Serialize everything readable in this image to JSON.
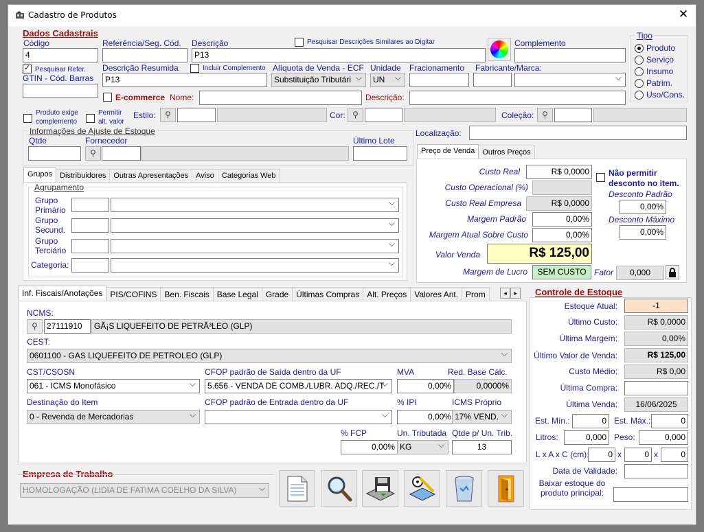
{
  "window": {
    "title": "Cadastro de Produtos",
    "close": "✕"
  },
  "dados": {
    "section": "Dados Cadastrais",
    "codigo_label": "Código",
    "codigo": "4",
    "ref_label": "Referência/Seg. Cód.",
    "ref": "",
    "desc_label": "Descrição",
    "desc": "P13",
    "pesquisar_similares": "Pesquisar Descrições Similares ao Digitar",
    "complemento_label": "Complemento",
    "complemento": "",
    "pesq_refer": "Pesquisar Refer.",
    "gtin_label": "GTIN - Cód. Barras",
    "gtin": "",
    "desc_resumida_label": "Descrição Resumida",
    "desc_resumida": "P13",
    "incluir_complemento": "Incluir Complemento",
    "aliquota_label": "Alíquota de Venda - ECF",
    "aliquota": "Substituição Tributári",
    "unidade_label": "Unidade",
    "unidade": "UN",
    "fracionamento_label": "Fracionamento",
    "fracionamento": "",
    "fabricante_label": "Fabricante/Marca:",
    "fabricante": "",
    "ecommerce": "E-commerce",
    "nome_label": "Nome:",
    "nome": "",
    "descricao2_label": "Descrição:",
    "descricao2": "",
    "exige_compl": "Produto exige complemento",
    "permitir_alt": "Permitir alt. valor",
    "estilo_label": "Estilo:",
    "cor_label": "Cor:",
    "colecao_label": "Coleção:"
  },
  "tipo": {
    "title": "Tipo",
    "options": [
      "Produto",
      "Serviço",
      "Insumo",
      "Patrim.",
      "Uso/Cons."
    ],
    "selected": 0
  },
  "ajuste": {
    "title": "Informações de Ajuste de Estoque",
    "qtde_label": "Qtde",
    "fornecedor_label": "Fornecedor",
    "ultimo_lote_label": "Último Lote"
  },
  "localizacao_label": "Localização:",
  "left_tabs": [
    "Grupos",
    "Distribuidores",
    "Outras Apresentações",
    "Aviso",
    "Categorias Web"
  ],
  "agrupamento": {
    "title": "Agrupamento",
    "gp1": "Grupo Primário",
    "gp2": "Grupo Secund.",
    "gp3": "Grupo Terciário",
    "categoria": "Categoria:"
  },
  "preco_tabs": [
    "Preço de Venda",
    "Outros Preços"
  ],
  "preco": {
    "custo_real_label": "Custo Real",
    "custo_real": "R$ 0,0000",
    "custo_op_label": "Custo Operacional (%)",
    "custo_op": "",
    "custo_emp_label": "Custo Real Empresa",
    "custo_emp": "R$ 0,0000",
    "margem_padrao_label": "Margem Padrão",
    "margem_padrao": "0,00%",
    "margem_atual_label": "Margem Atual Sobre Custo",
    "margem_atual": "0,00%",
    "valor_venda_label": "Valor Venda",
    "valor_venda": "R$ 125,00",
    "margem_lucro_label": "Margem de Lucro",
    "margem_lucro": "SEM CUSTO",
    "fator_label": "Fator",
    "fator": "0,000",
    "nao_permitir": "Não permitir desconto no item.",
    "desc_padrao_label": "Desconto Padrão",
    "desc_padrao": "0,00%",
    "desc_max_label": "Desconto Máximo",
    "desc_max": "0,00%"
  },
  "fiscal_tabs": [
    "Inf. Fiscais/Anotações",
    "PIS/COFINS",
    "Ben. Fiscais",
    "Base Legal",
    "Grade",
    "Últimas Compras",
    "Alt. Preços",
    "Valores Ant.",
    "Prom"
  ],
  "fiscal": {
    "ncms_label": "NCMS:",
    "ncm_code": "27111910",
    "ncm_desc": "GÃ¡S LIQUEFEITO DE PETRÃ³LEO (GLP)",
    "cest_label": "CEST:",
    "cest": "0601100 - GAS LIQUEFEITO DE PETROLEO (GLP)",
    "cst_label": "CST/CSOSN",
    "cst": "061 - ICMS Monofásico",
    "cfop_saida_label": "CFOP padrão de Saída dentro da UF",
    "cfop_saida": "5.656 - VENDA DE COMB./LUBR. ADQ./REC./T",
    "mva_label": "MVA",
    "mva": "0,00%",
    "red_base_label": "Red. Base Cálc.",
    "red_base": "0,0000%",
    "destinacao_label": "Destinação do Item",
    "destinacao": "0 - Revenda de Mercadorias",
    "cfop_entrada_label": "CFOP padrão de Entrada dentro da UF",
    "cfop_entrada": "",
    "ipi_label": "% IPI",
    "ipi": "0,00%",
    "icms_label": "ICMS Próprio",
    "icms": "17% VEND.",
    "fcp_label": "% FCP",
    "fcp": "0,00%",
    "un_trib_label": "Un. Tributada",
    "un_trib": "KG",
    "qtde_trib_label": "Qtde p/ Un. Trib.",
    "qtde_trib": "13"
  },
  "empresa": {
    "title": "Empresa de Trabalho",
    "value": "HOMOLOGAÇÃO  (LIDIA DE FATIMA COELHO DA SILVA)"
  },
  "estoque": {
    "title": "Controle de Estoque",
    "atual_label": "Estoque Atual:",
    "atual": "-1",
    "ult_custo_label": "Último Custo:",
    "ult_custo": "R$ 0,0000",
    "ult_margem_label": "Última Margem:",
    "ult_margem": "0,00%",
    "ult_valor_label": "Último Valor de Venda:",
    "ult_valor": "R$ 125,00",
    "custo_medio_label": "Custo Médio:",
    "custo_medio": "R$ 0,00",
    "ult_compra_label": "Última Compra:",
    "ult_compra": "",
    "ult_venda_label": "Última Venda:",
    "ult_venda": "16/06/2025",
    "min_label": "Est. Mín.:",
    "min": "0",
    "max_label": "Est. Máx.:",
    "max": "0",
    "litros_label": "Litros:",
    "litros": "0,000",
    "peso_label": "Peso:",
    "peso": "0,000",
    "lxaxc_label": "L x A x C (cm):",
    "l": "0",
    "a": "0",
    "c": "0",
    "x": "x",
    "validade_label": "Data de Validade:",
    "validade": "",
    "baixar_label": "Baixar estoque do produto principal:"
  }
}
